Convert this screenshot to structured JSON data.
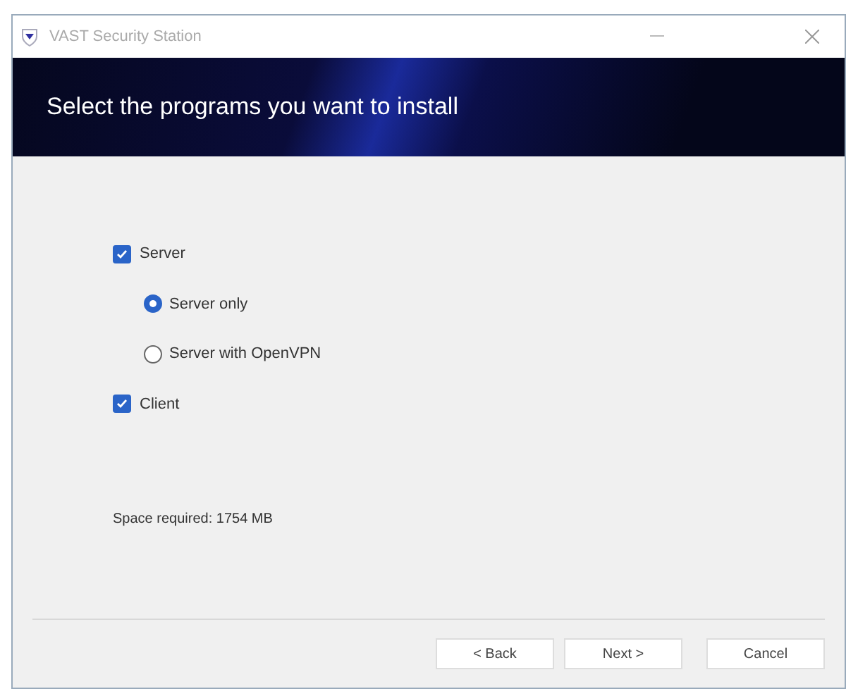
{
  "window": {
    "title": "VAST Security Station"
  },
  "banner": {
    "heading": "Select the programs you want to install"
  },
  "options": [
    {
      "kind": "checkbox",
      "label": "Server",
      "checked": true,
      "children": [
        {
          "kind": "radio",
          "label": "Server only",
          "selected": true
        },
        {
          "kind": "radio",
          "label": "Server with OpenVPN",
          "selected": false
        }
      ]
    },
    {
      "kind": "checkbox",
      "label": "Client",
      "checked": true
    }
  ],
  "space_required": "Space required: 1754 MB",
  "buttons": [
    {
      "label": "< Back"
    },
    {
      "label": "Next >"
    },
    {
      "label": "Cancel"
    }
  ]
}
